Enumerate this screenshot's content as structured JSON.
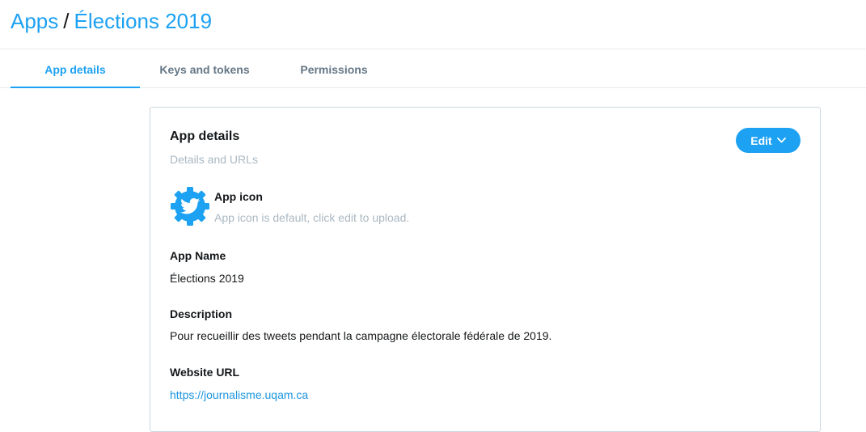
{
  "breadcrumb": {
    "root": "Apps",
    "separator": "/",
    "current": "Élections 2019"
  },
  "tabs": [
    {
      "label": "App details",
      "active": true
    },
    {
      "label": "Keys and tokens",
      "active": false
    },
    {
      "label": "Permissions",
      "active": false
    }
  ],
  "card": {
    "title": "App details",
    "subtitle": "Details and URLs",
    "edit_label": "Edit",
    "edit_icon": "chevron-down-icon",
    "app_icon": {
      "icon": "twitter-gear-icon",
      "label": "App icon",
      "help": "App icon is default, click edit to upload."
    },
    "fields": {
      "app_name": {
        "label": "App Name",
        "value": "Élections 2019"
      },
      "description": {
        "label": "Description",
        "value": "Pour recueillir des tweets pendant la campagne électorale fédérale de 2019."
      },
      "website": {
        "label": "Website URL",
        "value": "https://journalisme.uqam.ca"
      }
    }
  },
  "colors": {
    "accent": "#1da1f2",
    "link": "#1b95e0",
    "muted": "#aab8c2",
    "tab_inactive": "#657786",
    "text": "#14171a",
    "border": "#e6ecf0"
  }
}
